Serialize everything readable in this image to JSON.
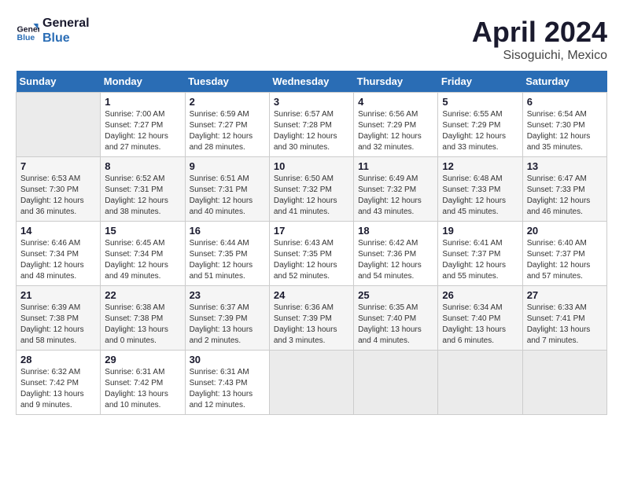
{
  "header": {
    "logo_line1": "General",
    "logo_line2": "Blue",
    "month": "April 2024",
    "location": "Sisoguichi, Mexico"
  },
  "days_of_week": [
    "Sunday",
    "Monday",
    "Tuesday",
    "Wednesday",
    "Thursday",
    "Friday",
    "Saturday"
  ],
  "weeks": [
    [
      {
        "day": "",
        "info": ""
      },
      {
        "day": "1",
        "info": "Sunrise: 7:00 AM\nSunset: 7:27 PM\nDaylight: 12 hours\nand 27 minutes."
      },
      {
        "day": "2",
        "info": "Sunrise: 6:59 AM\nSunset: 7:27 PM\nDaylight: 12 hours\nand 28 minutes."
      },
      {
        "day": "3",
        "info": "Sunrise: 6:57 AM\nSunset: 7:28 PM\nDaylight: 12 hours\nand 30 minutes."
      },
      {
        "day": "4",
        "info": "Sunrise: 6:56 AM\nSunset: 7:29 PM\nDaylight: 12 hours\nand 32 minutes."
      },
      {
        "day": "5",
        "info": "Sunrise: 6:55 AM\nSunset: 7:29 PM\nDaylight: 12 hours\nand 33 minutes."
      },
      {
        "day": "6",
        "info": "Sunrise: 6:54 AM\nSunset: 7:30 PM\nDaylight: 12 hours\nand 35 minutes."
      }
    ],
    [
      {
        "day": "7",
        "info": "Sunrise: 6:53 AM\nSunset: 7:30 PM\nDaylight: 12 hours\nand 36 minutes."
      },
      {
        "day": "8",
        "info": "Sunrise: 6:52 AM\nSunset: 7:31 PM\nDaylight: 12 hours\nand 38 minutes."
      },
      {
        "day": "9",
        "info": "Sunrise: 6:51 AM\nSunset: 7:31 PM\nDaylight: 12 hours\nand 40 minutes."
      },
      {
        "day": "10",
        "info": "Sunrise: 6:50 AM\nSunset: 7:32 PM\nDaylight: 12 hours\nand 41 minutes."
      },
      {
        "day": "11",
        "info": "Sunrise: 6:49 AM\nSunset: 7:32 PM\nDaylight: 12 hours\nand 43 minutes."
      },
      {
        "day": "12",
        "info": "Sunrise: 6:48 AM\nSunset: 7:33 PM\nDaylight: 12 hours\nand 45 minutes."
      },
      {
        "day": "13",
        "info": "Sunrise: 6:47 AM\nSunset: 7:33 PM\nDaylight: 12 hours\nand 46 minutes."
      }
    ],
    [
      {
        "day": "14",
        "info": "Sunrise: 6:46 AM\nSunset: 7:34 PM\nDaylight: 12 hours\nand 48 minutes."
      },
      {
        "day": "15",
        "info": "Sunrise: 6:45 AM\nSunset: 7:34 PM\nDaylight: 12 hours\nand 49 minutes."
      },
      {
        "day": "16",
        "info": "Sunrise: 6:44 AM\nSunset: 7:35 PM\nDaylight: 12 hours\nand 51 minutes."
      },
      {
        "day": "17",
        "info": "Sunrise: 6:43 AM\nSunset: 7:35 PM\nDaylight: 12 hours\nand 52 minutes."
      },
      {
        "day": "18",
        "info": "Sunrise: 6:42 AM\nSunset: 7:36 PM\nDaylight: 12 hours\nand 54 minutes."
      },
      {
        "day": "19",
        "info": "Sunrise: 6:41 AM\nSunset: 7:37 PM\nDaylight: 12 hours\nand 55 minutes."
      },
      {
        "day": "20",
        "info": "Sunrise: 6:40 AM\nSunset: 7:37 PM\nDaylight: 12 hours\nand 57 minutes."
      }
    ],
    [
      {
        "day": "21",
        "info": "Sunrise: 6:39 AM\nSunset: 7:38 PM\nDaylight: 12 hours\nand 58 minutes."
      },
      {
        "day": "22",
        "info": "Sunrise: 6:38 AM\nSunset: 7:38 PM\nDaylight: 13 hours\nand 0 minutes."
      },
      {
        "day": "23",
        "info": "Sunrise: 6:37 AM\nSunset: 7:39 PM\nDaylight: 13 hours\nand 2 minutes."
      },
      {
        "day": "24",
        "info": "Sunrise: 6:36 AM\nSunset: 7:39 PM\nDaylight: 13 hours\nand 3 minutes."
      },
      {
        "day": "25",
        "info": "Sunrise: 6:35 AM\nSunset: 7:40 PM\nDaylight: 13 hours\nand 4 minutes."
      },
      {
        "day": "26",
        "info": "Sunrise: 6:34 AM\nSunset: 7:40 PM\nDaylight: 13 hours\nand 6 minutes."
      },
      {
        "day": "27",
        "info": "Sunrise: 6:33 AM\nSunset: 7:41 PM\nDaylight: 13 hours\nand 7 minutes."
      }
    ],
    [
      {
        "day": "28",
        "info": "Sunrise: 6:32 AM\nSunset: 7:42 PM\nDaylight: 13 hours\nand 9 minutes."
      },
      {
        "day": "29",
        "info": "Sunrise: 6:31 AM\nSunset: 7:42 PM\nDaylight: 13 hours\nand 10 minutes."
      },
      {
        "day": "30",
        "info": "Sunrise: 6:31 AM\nSunset: 7:43 PM\nDaylight: 13 hours\nand 12 minutes."
      },
      {
        "day": "",
        "info": ""
      },
      {
        "day": "",
        "info": ""
      },
      {
        "day": "",
        "info": ""
      },
      {
        "day": "",
        "info": ""
      }
    ]
  ]
}
